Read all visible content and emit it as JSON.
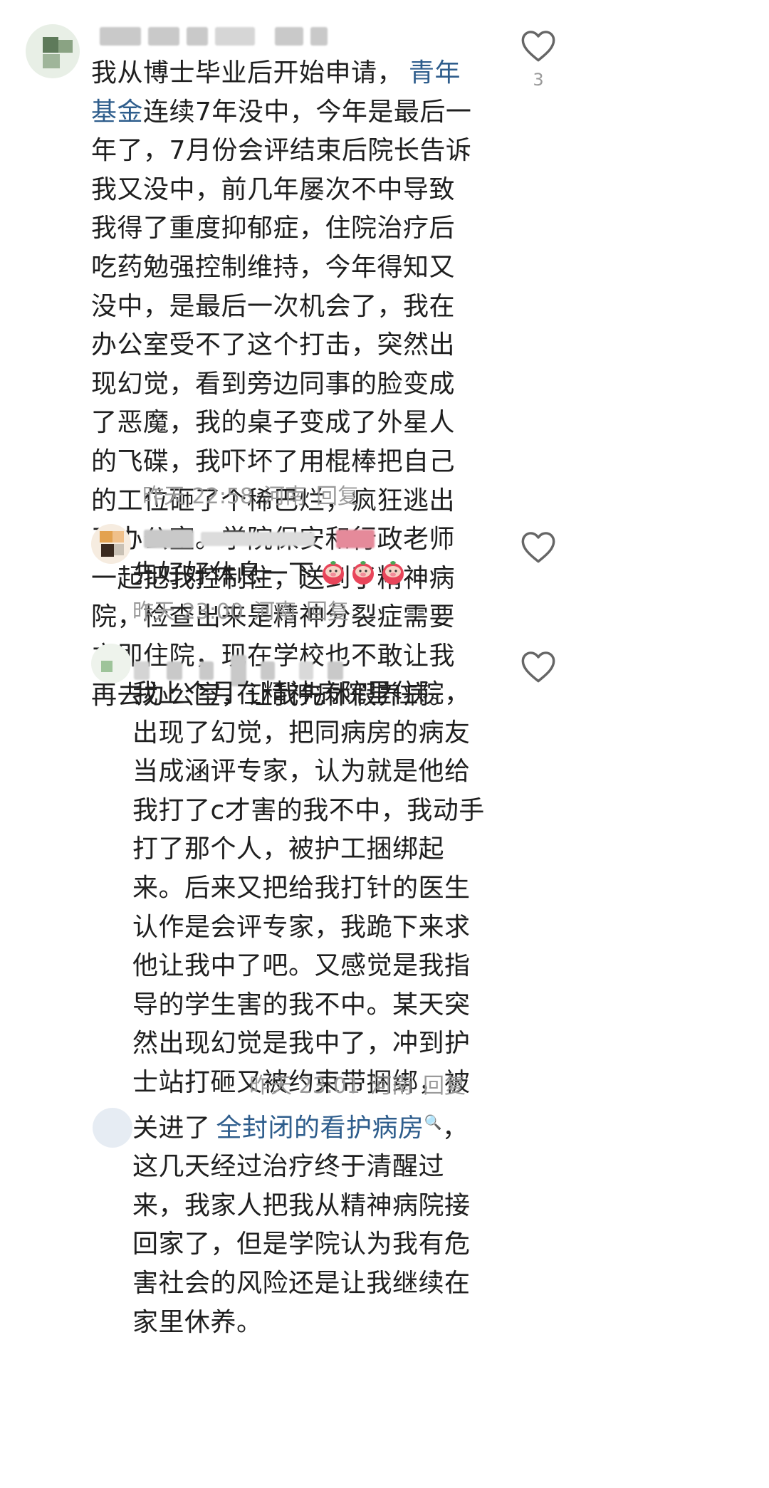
{
  "comments": [
    {
      "text_prefix": "我从博士毕业后开始申请，",
      "link": "青年基金",
      "text": "连续7年没中，今年是最后一年了，7月份会评结束后院长告诉我又没中，前几年屡次不中导致我得了重度抑郁症，住院治疗后吃药勉强控制维持，今年得知又没中，是最后一次机会了，我在办公室受不了这个打击，突然出现幻觉，看到旁边同事的脸变成了恶魔，我的桌子变成了外星人的飞碟，我吓坏了用棍棒把自己的工位砸了个稀巴烂，疯狂逃出了办公室。学院保安和行政老师一起把我控制住，送到了精神病院，检查出来是精神分裂症需要立即住院，现在学校也不敢让我再去办公室，让我先休假养病。",
      "time": "昨天 22:58",
      "location": "河南",
      "reply": "回复",
      "likes": "3"
    },
    {
      "text": "先好好休息一下",
      "emoji_count": 3,
      "time": "昨天 23:00",
      "location": "河南",
      "reply": "回复"
    },
    {
      "text_a": "我上个月在精神病院里住院，出现了幻觉，把同病房的病友当成涵评专家，认为就是他给我打了c才害的我不中，我动手打了那个人，被护工捆绑起来。后来又把给我打针的医生认作是会评专家，我跪下来求他让我中了吧。又感觉是我指导的学生害的我不中。某天突然出现幻觉是我中了，冲到护士站打砸又被约束带捆绑，被关进了",
      "link": "全封闭的看护病房",
      "text_b": "，这几天经过治疗终于清醒过来，我家人把我从精神病院接回家了，但是学院认为我有危害社会的风险还是让我继续在家里休养。",
      "time": "昨天 23:01",
      "location": "河南",
      "reply": "回复"
    }
  ],
  "colors": {
    "link": "#2e5d8c",
    "meta": "#9a9a9a",
    "text": "#1f1f1f"
  }
}
